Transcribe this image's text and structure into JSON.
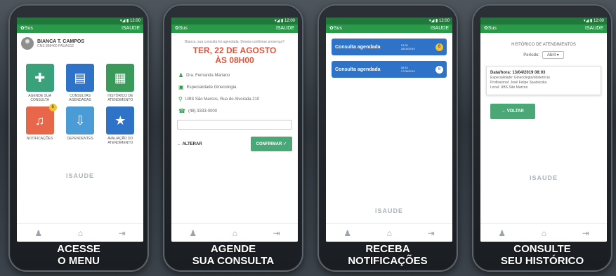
{
  "screens": [
    {
      "caption_line1": "ACESSE",
      "caption_line2": "O MENU",
      "appbar_left": "✿Sus",
      "appbar_right": "ISAUDE",
      "user_name": "BIANCA T. CAMPOS",
      "user_sub": "CNS 898400 PAUAS12",
      "tiles": [
        {
          "label": "AGENDE SUA CONSULTA",
          "color": "#3aa27a",
          "badge": ""
        },
        {
          "label": "CONSULTAS AGENDADAS",
          "color": "#2f73c9",
          "badge": ""
        },
        {
          "label": "HISTÓRICO DE ATENDIMENTO",
          "color": "#3a9a5a",
          "badge": ""
        },
        {
          "label": "NOTIFICAÇÕES",
          "color": "#e8674a",
          "badge": "6"
        },
        {
          "label": "DEPENDENTES",
          "color": "#4a9bd6",
          "badge": ""
        },
        {
          "label": "AVALIAÇÃO DO ATENDIMENTO",
          "color": "#2f73c9",
          "badge": ""
        }
      ],
      "brand": "ISAUDE"
    },
    {
      "caption_line1": "AGENDE",
      "caption_line2": "SUA CONSULTA",
      "appbar_left": "✿Sus",
      "appbar_right": "ISAUDE",
      "intro": "Bianca, sua consulta foi agendada. Deseja confirmar presença?",
      "date_line1": "TER, 22 DE AGOSTO",
      "date_line2": "ÀS 08H00",
      "info": [
        "Dra. Fernanda Mariano",
        "Especialidade Ginecologia",
        "UBS São Marcos, Rua do Alvorada 210",
        "(48) 3333-0000"
      ],
      "back_label": "← ALTERAR",
      "confirm_label": "CONFIRMAR ✓"
    },
    {
      "caption_line1": "RECEBA",
      "caption_line2": "NOTIFICAÇÕES",
      "appbar_left": "✿Sus",
      "appbar_right": "ISAUDE",
      "notifications": [
        {
          "title": "Consulta agendada",
          "time": "13:00",
          "date": "28/08/2019",
          "badge": "6",
          "white": false
        },
        {
          "title": "Consulta agendada",
          "time": "08:15",
          "date": "17/08/2019",
          "badge": "6",
          "white": true
        }
      ],
      "brand": "ISAUDE"
    },
    {
      "caption_line1": "CONSULTE",
      "caption_line2": "SEU HISTÓRICO",
      "appbar_left": "✿Sus",
      "appbar_right": "ISAUDE",
      "title": "HISTÓRICO DE ATENDIMENTOS",
      "period_label": "Período:",
      "period_value": "Abril",
      "card_date": "Data/hora: 13/04/2019 08:03",
      "card_lines": [
        "Especialidade: Ginecologia/obstetrícia",
        "Profissional: José Felipe Saudacska",
        "Local: UBS São Marcos"
      ],
      "back_label": "← VOLTAR",
      "brand": "ISAUDE"
    }
  ]
}
